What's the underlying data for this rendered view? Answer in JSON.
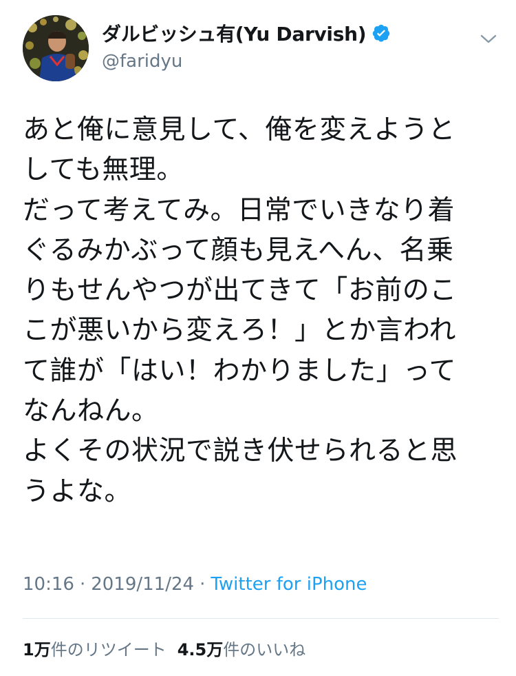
{
  "user": {
    "display_name": "ダルビッシュ有(Yu Darvish)",
    "handle": "@faridyu",
    "verified": true
  },
  "icons": {
    "avatar": "profile-photo",
    "verified": "verified-badge-icon",
    "menu": "chevron-down-icon"
  },
  "colors": {
    "verified_blue": "#1da1f2",
    "link_blue": "#1da1f2",
    "text": "#14171a",
    "secondary": "#657786"
  },
  "tweet": {
    "text": "あと俺に意見して、俺を変えようと\nしても無理。\nだって考えてみ。日常でいきなり着\nぐるみかぶって顔も見えへん、名乗\nりもせんやつが出てきて「お前のこ\nこが悪いから変えろ！」とか言われ\nて誰が「はい！わかりました」って\nなんねん。\nよくその状況で説き伏せられると思\nうよな。"
  },
  "meta": {
    "time": "10:16",
    "separator": "·",
    "date": "2019/11/24",
    "source": "Twitter for iPhone"
  },
  "stats": {
    "retweets_count": "1万",
    "retweets_label": "件のリツイート",
    "likes_count": "4.5万",
    "likes_label": "件のいいね"
  }
}
